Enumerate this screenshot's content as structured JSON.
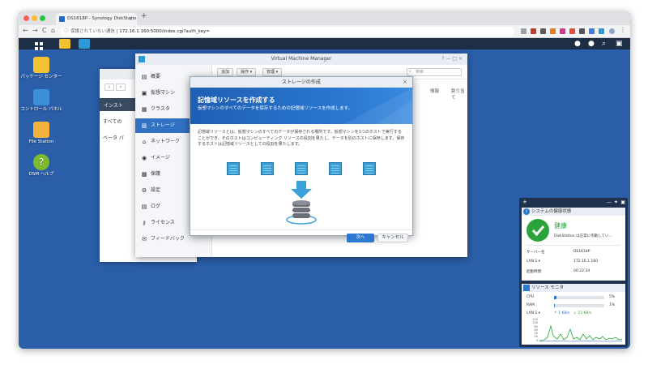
{
  "browser": {
    "tab_title": "DS1618P - Synology DiskStatio",
    "tab_close": "×",
    "new_tab": "+",
    "nav": {
      "back": "←",
      "forward": "→",
      "reload": "C",
      "home": "⌂"
    },
    "address_warning": "保護されていない通信",
    "address_url": "172.16.1.160:5000/index.cgi?auth_key="
  },
  "desktop": {
    "icons": [
      {
        "label": "パッケージ センター",
        "color": "#f2c230"
      },
      {
        "label": "コントロール パネル",
        "color": "#3b8fd8"
      },
      {
        "label": "File Station",
        "color": "#f3b23c"
      },
      {
        "label": "DSM ヘルプ",
        "color": "#7dbb2e"
      }
    ]
  },
  "back_window": {
    "nav_back": "‹",
    "nav_forward": "›",
    "items": [
      "インスト",
      "すべての",
      "ベータ パ"
    ]
  },
  "vmm": {
    "title": "Virtual Machine Manager",
    "toolbar": {
      "create": "追加",
      "action": "操作 ▾",
      "manage": "管理 ▾",
      "search_placeholder": "検索"
    },
    "columns": [
      "情報",
      "割り当て",
      "："
    ],
    "sidebar": [
      {
        "label": "概要",
        "icon": "▤"
      },
      {
        "label": "仮想マシン",
        "icon": "▣"
      },
      {
        "label": "クラスタ",
        "icon": "▦"
      },
      {
        "label": "ストレージ",
        "icon": "▥"
      },
      {
        "label": "ネットワーク",
        "icon": "⌂"
      },
      {
        "label": "イメージ",
        "icon": "◉"
      },
      {
        "label": "保護",
        "icon": "▩"
      },
      {
        "label": "設定",
        "icon": "⚙"
      },
      {
        "label": "ログ",
        "icon": "▤"
      },
      {
        "label": "ライセンス",
        "icon": "⚷"
      },
      {
        "label": "フィードバック",
        "icon": "✉"
      }
    ],
    "active_index": 3
  },
  "dialog": {
    "title": "ストレージの作成",
    "close": "×",
    "heading": "記憶域リソースを作成する",
    "subheading": "仮想マシンのすべてのデータを保存するための記憶域リソースを作成します。",
    "body": "記憶域リソースとは、仮想マシンのすべてのデータが保存される場所です。仮想マシンを1つのホストで実行することができ、そのホストはコンピューティング リソースの役割を果たし、データを別のホストに保存します。保存するホストは記憶域リソースとしての役割を果たします。",
    "next_button": "次へ",
    "cancel_button": "キャンセル"
  },
  "widgets": {
    "top_add": "+",
    "health": {
      "title": "システムの健康状態",
      "status": "健康",
      "message": "DiskStation は正常に作動してい...",
      "rows": [
        {
          "label": "サーバー名",
          "value": "DS1618P"
        },
        {
          "label": "LAN 1 ▾",
          "value": "172.16.1.160"
        },
        {
          "label": "起動時間",
          "value": "00:22:34"
        }
      ]
    },
    "resource": {
      "title": "リソース モニタ",
      "cpu_label": "CPU",
      "cpu_value": "5%",
      "cpu_fraction": 0.05,
      "ram_label": "RAM",
      "ram_value": "1%",
      "ram_fraction": 0.01,
      "lan_label": "LAN 1 ▾",
      "up": "↑ 1 KB/s",
      "down": "↓ 23 KB/s",
      "chart_ticks": [
        "120",
        "100",
        "80",
        "60",
        "40",
        "20",
        "0"
      ]
    }
  },
  "colors": {
    "desktop": "#2a5ea8",
    "accent": "#2c78d0",
    "health_green": "#2aa43a"
  }
}
